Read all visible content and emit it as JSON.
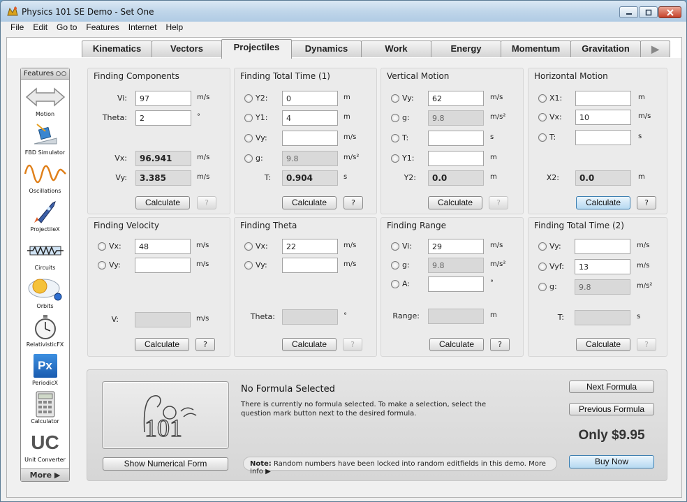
{
  "window": {
    "title": "Physics 101 SE Demo - Set One",
    "minimize": "▬",
    "maximize": "▢",
    "close": "✕"
  },
  "menu": [
    "File",
    "Edit",
    "Go to",
    "Features",
    "Internet",
    "Help"
  ],
  "tabs": [
    "Kinematics",
    "Vectors",
    "Projectiles",
    "Dynamics",
    "Work",
    "Energy",
    "Momentum",
    "Gravitation",
    "▶"
  ],
  "active_tab": "Projectiles",
  "sidebar": {
    "header": "Features",
    "items": [
      "Motion",
      "FBD Simulator",
      "Oscillations",
      "ProjectileX",
      "Circuits",
      "Orbits",
      "RelativisticFX",
      "PeriodicX",
      "Calculator",
      "Unit Converter"
    ],
    "periodicx_glyph": "Px",
    "unitconverter_glyph": "UC",
    "more": "More ▶"
  },
  "panels": {
    "finding_components": {
      "title": "Finding Components",
      "vi_label": "Vi:",
      "vi_value": "97",
      "vi_unit": "m/s",
      "theta_label": "Theta:",
      "theta_value": "2",
      "theta_unit": "°",
      "vx_label": "Vx:",
      "vx_value": "96.941",
      "vx_unit": "m/s",
      "vy_label": "Vy:",
      "vy_value": "3.385",
      "vy_unit": "m/s",
      "calc": "Calculate",
      "q": "?"
    },
    "finding_total_time_1": {
      "title": "Finding Total Time (1)",
      "y2_label": "Y2:",
      "y2_value": "0",
      "y2_unit": "m",
      "y1_label": "Y1:",
      "y1_value": "4",
      "y1_unit": "m",
      "vy_label": "Vy:",
      "vy_value": "",
      "vy_unit": "m/s",
      "g_label": "g:",
      "g_value": "9.8",
      "g_unit": "m/s²",
      "t_label": "T:",
      "t_value": "0.904",
      "t_unit": "s",
      "calc": "Calculate",
      "q": "?"
    },
    "vertical_motion": {
      "title": "Vertical Motion",
      "vy_label": "Vy:",
      "vy_value": "62",
      "vy_unit": "m/s",
      "g_label": "g:",
      "g_value": "9.8",
      "g_unit": "m/s²",
      "t_label": "T:",
      "t_value": "",
      "t_unit": "s",
      "y1_label": "Y1:",
      "y1_value": "",
      "y1_unit": "m",
      "y2_label": "Y2:",
      "y2_value": "0.0",
      "y2_unit": "m",
      "calc": "Calculate",
      "q": "?"
    },
    "horizontal_motion": {
      "title": "Horizontal Motion",
      "x1_label": "X1:",
      "x1_value": "",
      "x1_unit": "m",
      "vx_label": "Vx:",
      "vx_value": "10",
      "vx_unit": "m/s",
      "t_label": "T:",
      "t_value": "",
      "t_unit": "s",
      "x2_label": "X2:",
      "x2_value": "0.0",
      "x2_unit": "m",
      "calc": "Calculate",
      "q": "?"
    },
    "finding_velocity": {
      "title": "Finding Velocity",
      "vx_label": "Vx:",
      "vx_value": "48",
      "vx_unit": "m/s",
      "vy_label": "Vy:",
      "vy_value": "",
      "vy_unit": "m/s",
      "v_label": "V:",
      "v_value": "",
      "v_unit": "m/s",
      "calc": "Calculate",
      "q": "?"
    },
    "finding_theta": {
      "title": "Finding Theta",
      "vx_label": "Vx:",
      "vx_value": "22",
      "vx_unit": "m/s",
      "vy_label": "Vy:",
      "vy_value": "",
      "vy_unit": "m/s",
      "theta_label": "Theta:",
      "theta_value": "",
      "theta_unit": "°",
      "calc": "Calculate",
      "q": "?"
    },
    "finding_range": {
      "title": "Finding Range",
      "vi_label": "Vi:",
      "vi_value": "29",
      "vi_unit": "m/s",
      "g_label": "g:",
      "g_value": "9.8",
      "g_unit": "m/s²",
      "a_label": "A:",
      "a_value": "",
      "a_unit": "°",
      "range_label": "Range:",
      "range_value": "",
      "range_unit": "m",
      "calc": "Calculate",
      "q": "?"
    },
    "finding_total_time_2": {
      "title": "Finding Total Time (2)",
      "vy_label": "Vy:",
      "vy_value": "",
      "vy_unit": "m/s",
      "vyf_label": "Vyf:",
      "vyf_value": "13",
      "vyf_unit": "m/s",
      "g_label": "g:",
      "g_value": "9.8",
      "g_unit": "m/s²",
      "t_label": "T:",
      "t_value": "",
      "t_unit": "s",
      "calc": "Calculate",
      "q": "?"
    }
  },
  "bottom": {
    "formula_title": "No Formula Selected",
    "formula_desc": "There is currently no formula selected. To make a selection, select the question mark button next to the desired formula.",
    "logo_text": "101",
    "show_numerical": "Show Numerical Form",
    "note_bold": "Note:",
    "note_text": " Random numbers have been locked into random editfields in this demo. More Info ▶",
    "next_formula": "Next Formula",
    "previous_formula": "Previous Formula",
    "price": "Only $9.95",
    "buy_now": "Buy Now"
  }
}
